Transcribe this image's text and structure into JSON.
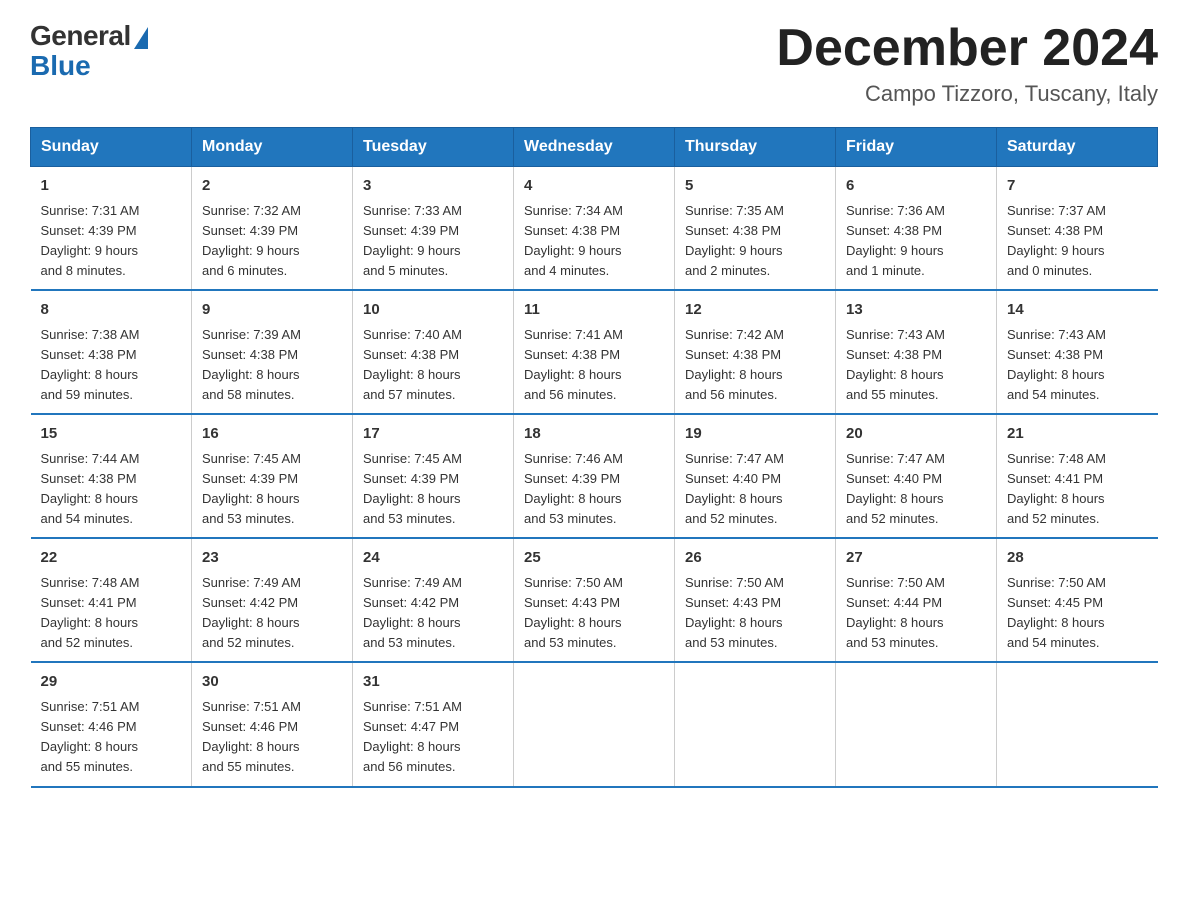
{
  "logo": {
    "general": "General",
    "blue": "Blue"
  },
  "title": "December 2024",
  "location": "Campo Tizzoro, Tuscany, Italy",
  "headers": [
    "Sunday",
    "Monday",
    "Tuesday",
    "Wednesday",
    "Thursday",
    "Friday",
    "Saturday"
  ],
  "weeks": [
    [
      {
        "day": "1",
        "info": "Sunrise: 7:31 AM\nSunset: 4:39 PM\nDaylight: 9 hours\nand 8 minutes."
      },
      {
        "day": "2",
        "info": "Sunrise: 7:32 AM\nSunset: 4:39 PM\nDaylight: 9 hours\nand 6 minutes."
      },
      {
        "day": "3",
        "info": "Sunrise: 7:33 AM\nSunset: 4:39 PM\nDaylight: 9 hours\nand 5 minutes."
      },
      {
        "day": "4",
        "info": "Sunrise: 7:34 AM\nSunset: 4:38 PM\nDaylight: 9 hours\nand 4 minutes."
      },
      {
        "day": "5",
        "info": "Sunrise: 7:35 AM\nSunset: 4:38 PM\nDaylight: 9 hours\nand 2 minutes."
      },
      {
        "day": "6",
        "info": "Sunrise: 7:36 AM\nSunset: 4:38 PM\nDaylight: 9 hours\nand 1 minute."
      },
      {
        "day": "7",
        "info": "Sunrise: 7:37 AM\nSunset: 4:38 PM\nDaylight: 9 hours\nand 0 minutes."
      }
    ],
    [
      {
        "day": "8",
        "info": "Sunrise: 7:38 AM\nSunset: 4:38 PM\nDaylight: 8 hours\nand 59 minutes."
      },
      {
        "day": "9",
        "info": "Sunrise: 7:39 AM\nSunset: 4:38 PM\nDaylight: 8 hours\nand 58 minutes."
      },
      {
        "day": "10",
        "info": "Sunrise: 7:40 AM\nSunset: 4:38 PM\nDaylight: 8 hours\nand 57 minutes."
      },
      {
        "day": "11",
        "info": "Sunrise: 7:41 AM\nSunset: 4:38 PM\nDaylight: 8 hours\nand 56 minutes."
      },
      {
        "day": "12",
        "info": "Sunrise: 7:42 AM\nSunset: 4:38 PM\nDaylight: 8 hours\nand 56 minutes."
      },
      {
        "day": "13",
        "info": "Sunrise: 7:43 AM\nSunset: 4:38 PM\nDaylight: 8 hours\nand 55 minutes."
      },
      {
        "day": "14",
        "info": "Sunrise: 7:43 AM\nSunset: 4:38 PM\nDaylight: 8 hours\nand 54 minutes."
      }
    ],
    [
      {
        "day": "15",
        "info": "Sunrise: 7:44 AM\nSunset: 4:38 PM\nDaylight: 8 hours\nand 54 minutes."
      },
      {
        "day": "16",
        "info": "Sunrise: 7:45 AM\nSunset: 4:39 PM\nDaylight: 8 hours\nand 53 minutes."
      },
      {
        "day": "17",
        "info": "Sunrise: 7:45 AM\nSunset: 4:39 PM\nDaylight: 8 hours\nand 53 minutes."
      },
      {
        "day": "18",
        "info": "Sunrise: 7:46 AM\nSunset: 4:39 PM\nDaylight: 8 hours\nand 53 minutes."
      },
      {
        "day": "19",
        "info": "Sunrise: 7:47 AM\nSunset: 4:40 PM\nDaylight: 8 hours\nand 52 minutes."
      },
      {
        "day": "20",
        "info": "Sunrise: 7:47 AM\nSunset: 4:40 PM\nDaylight: 8 hours\nand 52 minutes."
      },
      {
        "day": "21",
        "info": "Sunrise: 7:48 AM\nSunset: 4:41 PM\nDaylight: 8 hours\nand 52 minutes."
      }
    ],
    [
      {
        "day": "22",
        "info": "Sunrise: 7:48 AM\nSunset: 4:41 PM\nDaylight: 8 hours\nand 52 minutes."
      },
      {
        "day": "23",
        "info": "Sunrise: 7:49 AM\nSunset: 4:42 PM\nDaylight: 8 hours\nand 52 minutes."
      },
      {
        "day": "24",
        "info": "Sunrise: 7:49 AM\nSunset: 4:42 PM\nDaylight: 8 hours\nand 53 minutes."
      },
      {
        "day": "25",
        "info": "Sunrise: 7:50 AM\nSunset: 4:43 PM\nDaylight: 8 hours\nand 53 minutes."
      },
      {
        "day": "26",
        "info": "Sunrise: 7:50 AM\nSunset: 4:43 PM\nDaylight: 8 hours\nand 53 minutes."
      },
      {
        "day": "27",
        "info": "Sunrise: 7:50 AM\nSunset: 4:44 PM\nDaylight: 8 hours\nand 53 minutes."
      },
      {
        "day": "28",
        "info": "Sunrise: 7:50 AM\nSunset: 4:45 PM\nDaylight: 8 hours\nand 54 minutes."
      }
    ],
    [
      {
        "day": "29",
        "info": "Sunrise: 7:51 AM\nSunset: 4:46 PM\nDaylight: 8 hours\nand 55 minutes."
      },
      {
        "day": "30",
        "info": "Sunrise: 7:51 AM\nSunset: 4:46 PM\nDaylight: 8 hours\nand 55 minutes."
      },
      {
        "day": "31",
        "info": "Sunrise: 7:51 AM\nSunset: 4:47 PM\nDaylight: 8 hours\nand 56 minutes."
      },
      {
        "day": "",
        "info": ""
      },
      {
        "day": "",
        "info": ""
      },
      {
        "day": "",
        "info": ""
      },
      {
        "day": "",
        "info": ""
      }
    ]
  ]
}
